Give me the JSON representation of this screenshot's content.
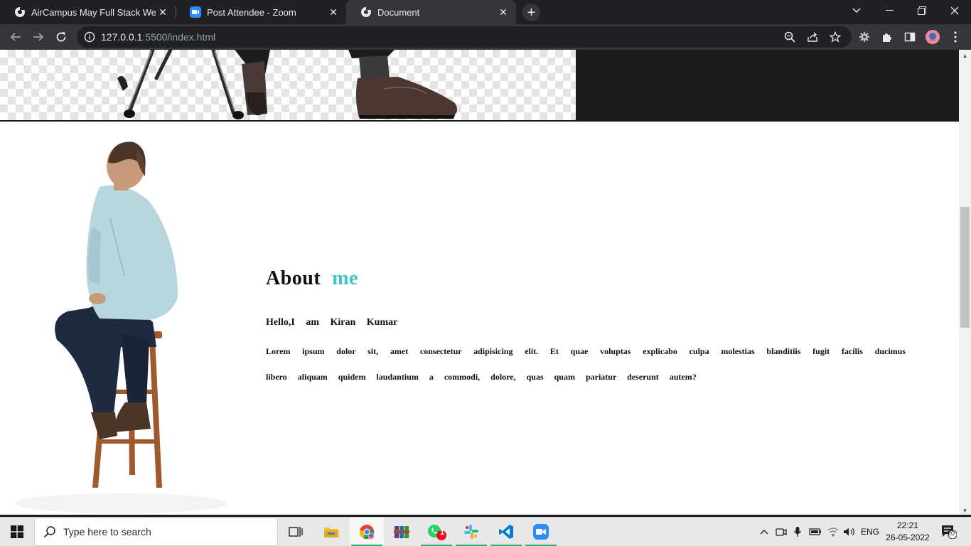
{
  "browser": {
    "tabs": [
      {
        "title": "AirCampus May Full Stack Web D",
        "favicon": "chrome-globe-icon"
      },
      {
        "title": "Post Attendee - Zoom",
        "favicon": "zoom-icon"
      },
      {
        "title": "Document",
        "favicon": "chrome-globe-icon",
        "active": true
      }
    ],
    "url_host": "127.0.0.1",
    "url_path": ":5500/index.html"
  },
  "page": {
    "about": {
      "heading": "About",
      "heading_accent": "me",
      "greeting": "Hello,I am Kiran Kumar",
      "body": "Lorem ipsum dolor sit, amet consectetur adipisicing elit. Et quae voluptas explicabo culpa molestias blanditiis fugit facilis ducimus libero aliquam quidem laudantium a commodi, dolore, quas quam pariatur deserunt autem?"
    }
  },
  "taskbar": {
    "search_placeholder": "Type here to search",
    "whatsapp_badge": "1",
    "language": "ENG",
    "time": "22:21",
    "date": "26-05-2022",
    "notifications": "20"
  },
  "colors": {
    "accent": "#3ec3cf",
    "tab_strip": "#202124",
    "toolbar": "#35363a",
    "hero_dark": "#1b1b1b"
  }
}
